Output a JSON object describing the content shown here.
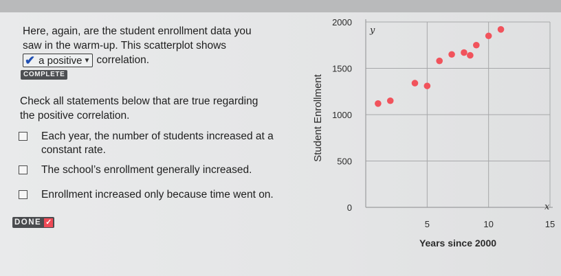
{
  "intro": {
    "line1": "Here, again, are the student enrollment data you",
    "line2": "saw in the warm-up. This scatterplot shows",
    "selected_value": "a positive",
    "after_select": "correlation."
  },
  "badge_complete": "COMPLETE",
  "prompt": {
    "line1": "Check all statements below that are true regarding",
    "line2": "the positive correlation."
  },
  "options": [
    {
      "text": "Each year, the number of students increased at a constant rate.",
      "checked": false
    },
    {
      "text": "The school’s enrollment generally increased.",
      "checked": false
    },
    {
      "text": "Enrollment increased only because time went on.",
      "checked": false
    }
  ],
  "done_label": "DONE",
  "icons": {
    "select_check": "checkmark-icon",
    "select_chevron": "chevron-down-icon",
    "done_check": "checkmark-icon"
  },
  "colors": {
    "points": "#f1535c",
    "grid": "#a6a7a9",
    "done_check_bg": "#ef4a56",
    "select_check": "#1f4fb3"
  },
  "chart_data": {
    "type": "scatter",
    "title": "",
    "xlabel": "Years since 2000",
    "ylabel": "Student Enrollment",
    "x_axis_var": "x",
    "y_axis_var": "y",
    "xlim": [
      0,
      15
    ],
    "ylim": [
      0,
      2000
    ],
    "x_ticks": [
      "5",
      "10",
      "15"
    ],
    "y_ticks": [
      "0",
      "500",
      "1000",
      "1500",
      "2000"
    ],
    "grid": true,
    "x": [
      1,
      2,
      4,
      5,
      6,
      7,
      8,
      8.5,
      9,
      10,
      11
    ],
    "y": [
      1120,
      1150,
      1340,
      1310,
      1580,
      1650,
      1670,
      1640,
      1750,
      1850,
      1920
    ]
  }
}
